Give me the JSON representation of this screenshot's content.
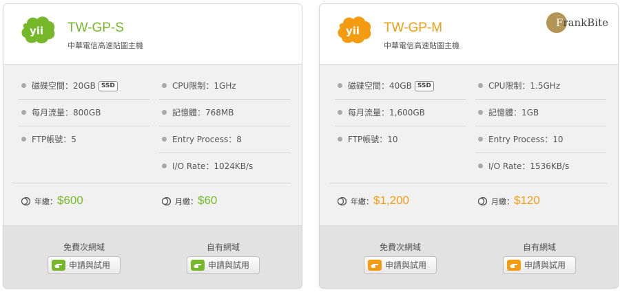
{
  "plans": [
    {
      "name": "TW-GP-S",
      "subtitle": "中華電信高速貼圖主機",
      "accent": "#77b82a",
      "logo_icon": "yui-cloud-logo-icon",
      "specs_left": [
        {
          "label": "磁碟空間：",
          "value": "20GB",
          "badge": "SSD"
        },
        {
          "label": "每月流量：",
          "value": "800GB"
        },
        {
          "label": "FTP帳號：",
          "value": "5"
        }
      ],
      "specs_right": [
        {
          "label": "CPU限制：",
          "value": "1GHz"
        },
        {
          "label": "記憶體：",
          "value": "768MB"
        },
        {
          "label": "Entry Process：",
          "value": "8"
        },
        {
          "label": "I/O Rate：",
          "value": "1024KB/s"
        }
      ],
      "price_year_label": "年繳：",
      "price_year": "$600",
      "price_month_label": "月繳：",
      "price_month": "$60",
      "footer": [
        {
          "label": "免費次網域",
          "button": "申請與試用"
        },
        {
          "label": "自有網域",
          "button": "申請與試用"
        }
      ]
    },
    {
      "name": "TW-GP-M",
      "subtitle": "中華電信高速貼圖主機",
      "accent": "#f39c12",
      "logo_icon": "yui-cloud-logo-icon",
      "specs_left": [
        {
          "label": "磁碟空間：",
          "value": "40GB",
          "badge": "SSD"
        },
        {
          "label": "每月流量：",
          "value": "1,600GB"
        },
        {
          "label": "FTP帳號：",
          "value": "10"
        }
      ],
      "specs_right": [
        {
          "label": "CPU限制：",
          "value": "1.5GHz"
        },
        {
          "label": "記憶體：",
          "value": "1GB"
        },
        {
          "label": "Entry Process：",
          "value": "10"
        },
        {
          "label": "I/O Rate：",
          "value": "1536KB/s"
        }
      ],
      "price_year_label": "年繳：",
      "price_year": "$1,200",
      "price_month_label": "月繳：",
      "price_month": "$120",
      "footer": [
        {
          "label": "免費次網域",
          "button": "申請與試用"
        },
        {
          "label": "自有網域",
          "button": "申請與試用"
        }
      ]
    }
  ],
  "watermark": {
    "first": "F",
    "rest": "rankBite"
  }
}
